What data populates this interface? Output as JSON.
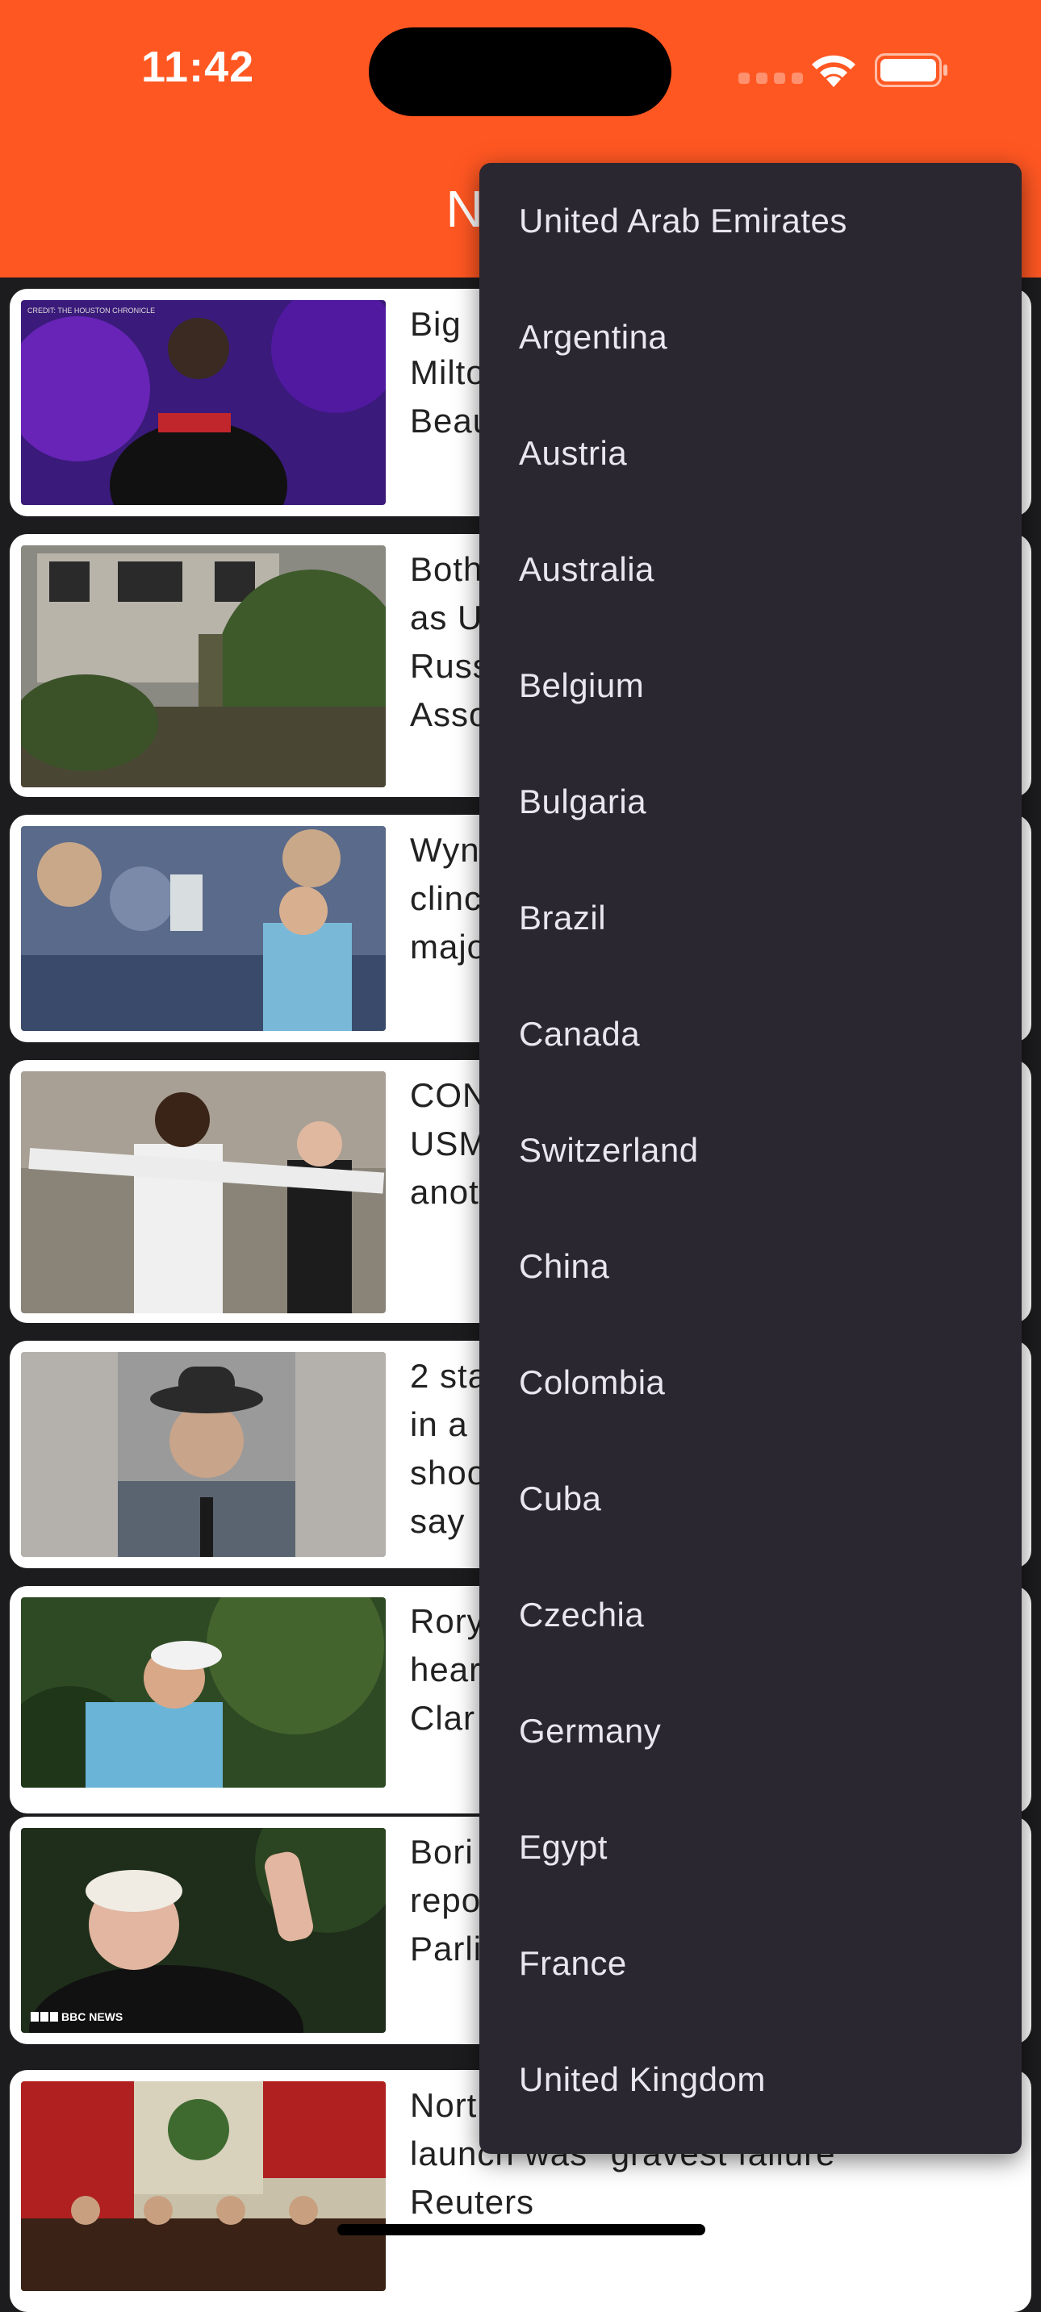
{
  "status_bar": {
    "time": "11:42"
  },
  "header": {
    "title": "New A"
  },
  "articles": [
    {
      "text": "Big\nMilto\nBeau"
    },
    {
      "text": "Both\nas U\nRuss\nAsso"
    },
    {
      "text": "Wyn\nclinc\nmajo"
    },
    {
      "text": "CON\nUSM\nanot"
    },
    {
      "text": "2 sta\nin a \nshoo\nsay"
    },
    {
      "text": "Rory\nhear\nClar"
    },
    {
      "text": "Bori\nrepo\nParli"
    },
    {
      "text": "Nort\nlaunch was \"gravest failure\"\nReuters"
    }
  ],
  "country_menu": {
    "items": [
      "United Arab Emirates",
      "Argentina",
      "Austria",
      "Australia",
      "Belgium",
      "Bulgaria",
      "Brazil",
      "Canada",
      "Switzerland",
      "China",
      "Colombia",
      "Cuba",
      "Czechia",
      "Germany",
      "Egypt",
      "France",
      "United Kingdom"
    ]
  },
  "thumbnail_watermarks": {
    "bbc": "BBC NEWS",
    "credit": "CREDIT: THE HOUSTON CHRONICLE"
  },
  "colors": {
    "accent": "#ff5722",
    "menu_bg": "#2a2730"
  }
}
